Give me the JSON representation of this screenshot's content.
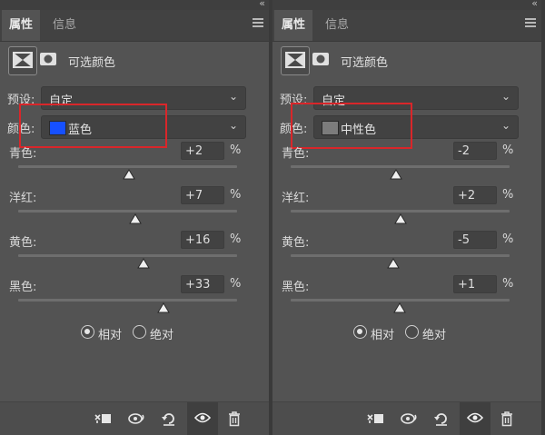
{
  "panels": [
    {
      "tabs": [
        {
          "label": "属性"
        },
        {
          "label": "信息"
        }
      ],
      "header_title": "可选颜色",
      "preset": {
        "label": "预设:",
        "value": "自定"
      },
      "colors": {
        "label": "颜色:",
        "value": "蓝色",
        "swatch": "#1650ff"
      },
      "sliders": [
        {
          "label": "青色:",
          "value": "+2",
          "unit": "%",
          "pct": 0
        },
        {
          "label": "洋红:",
          "value": "+7",
          "unit": "%",
          "pct": 0
        },
        {
          "label": "黄色:",
          "value": "+16",
          "unit": "%",
          "pct": 0
        },
        {
          "label": "黑色:",
          "value": "+33",
          "unit": "%",
          "pct": 0
        }
      ],
      "method": {
        "relative": "相对",
        "absolute": "绝对",
        "selected": "relative"
      }
    },
    {
      "tabs": [
        {
          "label": "属性"
        },
        {
          "label": "信息"
        }
      ],
      "header_title": "可选颜色",
      "preset": {
        "label": "预设:",
        "value": "自定"
      },
      "colors": {
        "label": "颜色:",
        "value": "中性色",
        "swatch": "#7c7c7c"
      },
      "sliders": [
        {
          "label": "青色:",
          "value": "-2",
          "unit": "%",
          "pct": 0
        },
        {
          "label": "洋红:",
          "value": "+2",
          "unit": "%",
          "pct": 0
        },
        {
          "label": "黄色:",
          "value": "-5",
          "unit": "%",
          "pct": 0
        },
        {
          "label": "黑色:",
          "value": "+1",
          "unit": "%",
          "pct": 0
        }
      ],
      "method": {
        "relative": "相对",
        "absolute": "绝对",
        "selected": "relative"
      }
    }
  ],
  "accent_highlight": "#d9262a"
}
